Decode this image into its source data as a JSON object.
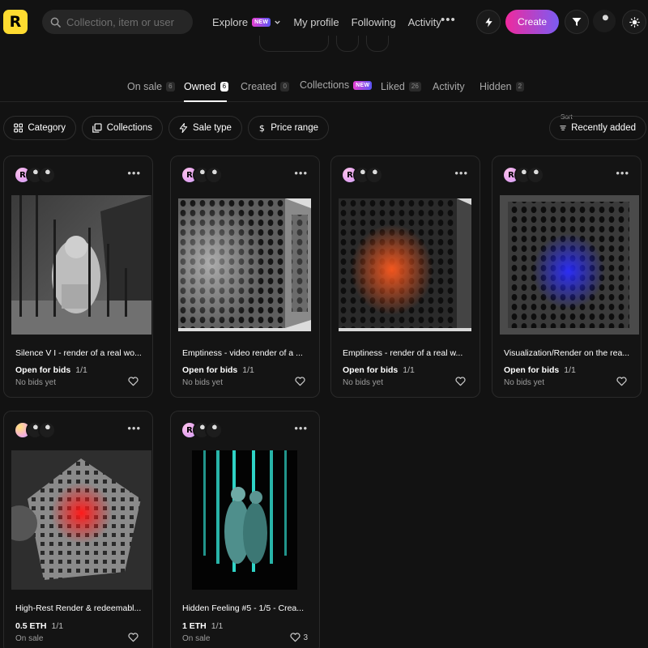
{
  "header": {
    "logo_letter": "R",
    "search": {
      "placeholder": "Collection, item or user"
    },
    "nav": [
      {
        "label": "Explore",
        "badge": "NEW"
      },
      {
        "label": "My profile"
      },
      {
        "label": "Following"
      },
      {
        "label": "Activity"
      }
    ],
    "more": "•••",
    "create_label": "Create"
  },
  "tabs": [
    {
      "label": "On sale",
      "count": "6"
    },
    {
      "label": "Owned",
      "count": "6",
      "active": true
    },
    {
      "label": "Created",
      "count": "0"
    },
    {
      "label": "Collections",
      "badge": "NEW"
    },
    {
      "label": "Liked",
      "count": "26"
    },
    {
      "label": "Activity"
    },
    {
      "label": "Hidden",
      "count": "2"
    }
  ],
  "filters": {
    "category": "Category",
    "collections": "Collections",
    "sale_type": "Sale type",
    "price_range": "Price range",
    "sort_label": "Sort",
    "sort_value": "Recently added"
  },
  "cards": [
    {
      "title": "Silence V I - render of a real wo...",
      "status": "Open for bids",
      "edition": "1/1",
      "sub": "No bids yet",
      "likes": ""
    },
    {
      "title": "Emptiness - video render of a ...",
      "status": "Open for bids",
      "edition": "1/1",
      "sub": "No bids yet",
      "likes": ""
    },
    {
      "title": "Emptiness - render of a real w...",
      "status": "Open for bids",
      "edition": "1/1",
      "sub": "No bids yet",
      "likes": ""
    },
    {
      "title": "Visualization/Render on the rea...",
      "status": "Open for bids",
      "edition": "1/1",
      "sub": "No bids yet",
      "likes": ""
    },
    {
      "title": "High-Rest Render & redeemabl...",
      "status": "0.5 ETH",
      "edition": "1/1",
      "sub": "On sale",
      "likes": ""
    },
    {
      "title": "Hidden Feeling #5 - 1/5 - Crea...",
      "status": "1 ETH",
      "edition": "1/1",
      "sub": "On sale",
      "likes": "3"
    }
  ],
  "colors": {
    "background": "#121212",
    "logo": "#fedb30",
    "create_gradient_start": "#f0299d",
    "create_gradient_end": "#7b5cf3"
  }
}
